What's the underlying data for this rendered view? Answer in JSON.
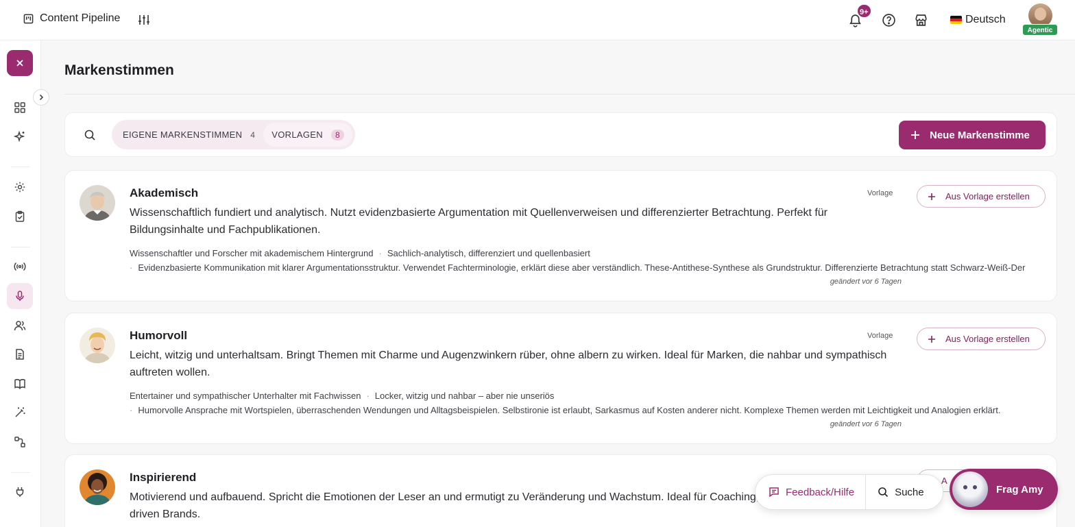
{
  "topbar": {
    "app_title": "Content Pipeline",
    "notification_badge": "9+",
    "language": "Deutsch",
    "user_badge": "Agentic"
  },
  "page": {
    "title": "Markenstimmen"
  },
  "toolbar": {
    "tabs": [
      {
        "label": "EIGENE MARKENSTIMMEN",
        "count": "4",
        "active": false
      },
      {
        "label": "VORLAGEN",
        "count": "8",
        "active": true
      }
    ],
    "new_button": "Neue Markenstimme"
  },
  "cards": [
    {
      "name": "Akademisch",
      "description": "Wissenschaftlich fundiert und analytisch. Nutzt evidenzbasierte Argumentation mit Quellenverweisen und differenzierter Betrachtung. Perfekt für Bildungsinhalte und Fachpublikationen.",
      "tag": "Vorlage",
      "action": "Aus Vorlage erstellen",
      "persona": "Wissenschaftler und Forscher mit akademischem Hintergrund",
      "tone": "Sachlich-analytisch, differenziert und quellenbasiert",
      "style": "Evidenzbasierte Kommunikation mit klarer Argumentationsstruktur. Verwendet Fachterminologie, erklärt diese aber verständlich. These-Antithese-Synthese als Grundstruktur. Differenzierte Betrachtung statt Schwarz-Weiß-Der",
      "changed": "geändert vor 6 Tagen"
    },
    {
      "name": "Humorvoll",
      "description": "Leicht, witzig und unterhaltsam. Bringt Themen mit Charme und Augenzwinkern rüber, ohne albern zu wirken. Ideal für Marken, die nahbar und sympathisch auftreten wollen.",
      "tag": "Vorlage",
      "action": "Aus Vorlage erstellen",
      "persona": "Entertainer und sympathischer Unterhalter mit Fachwissen",
      "tone": "Locker, witzig und nahbar – aber nie unseriös",
      "style": "Humorvolle Ansprache mit Wortspielen, überraschenden Wendungen und Alltagsbeispielen. Selbstironie ist erlaubt, Sarkasmus auf Kosten anderer nicht. Komplexe Themen werden mit Leichtigkeit und Analogien erklärt.",
      "changed": "geändert vor 6 Tagen"
    },
    {
      "name": "Inspirierend",
      "description": "Motivierend und aufbauend. Spricht die Emotionen der Leser an und ermutigt zu Veränderung und Wachstum. Ideal für Coaching, Per",
      "description_line2": "driven Brands.",
      "action_partial": "A"
    }
  ],
  "floating": {
    "feedback": "Feedback/Hilfe",
    "search": "Suche",
    "assistant": "Frag Amy"
  },
  "colors": {
    "brand": "#9b2b6f",
    "badge_green": "#2e9b55"
  }
}
